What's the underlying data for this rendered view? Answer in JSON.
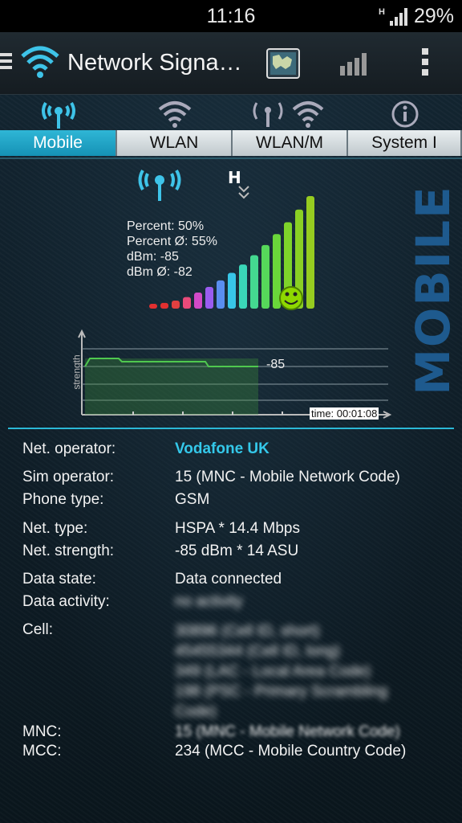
{
  "status_bar": {
    "time": "11:16",
    "network_type": "H",
    "battery": "29%"
  },
  "app_bar": {
    "title": "Network Signa…"
  },
  "tabs": [
    {
      "label": "Mobile",
      "active": true,
      "icon": "antenna-icon"
    },
    {
      "label": "WLAN",
      "active": false,
      "icon": "wifi-icon"
    },
    {
      "label": "WLAN/M",
      "active": false,
      "icon": "antenna-wifi-icon"
    },
    {
      "label": "System I",
      "active": false,
      "icon": "info-icon"
    }
  ],
  "side_label": "MOBILE",
  "signal": {
    "network_indicator": "H",
    "percent": "Percent: 50%",
    "percent_avg": "Percent Ø: 55%",
    "dbm": "dBm: -85",
    "dbm_avg": "dBm Ø: -82",
    "level": 0.5
  },
  "graph": {
    "y_label": "strength",
    "current_value": "-85",
    "time_label": "time: 00:01:08"
  },
  "details": {
    "net_operator": {
      "label": "Net. operator:",
      "value": "Vodafone UK"
    },
    "sim_operator": {
      "label": "Sim operator:",
      "value": "15 (MNC - Mobile Network Code)"
    },
    "phone_type": {
      "label": "Phone type:",
      "value": "GSM"
    },
    "net_type": {
      "label": "Net. type:",
      "value": "HSPA * 14.4 Mbps"
    },
    "net_strength": {
      "label": "Net. strength:",
      "value": "-85 dBm * 14 ASU"
    },
    "data_state": {
      "label": "Data state:",
      "value": "Data connected"
    },
    "data_activity": {
      "label": "Data activity:",
      "value": "no activity"
    },
    "cell": {
      "label": "Cell:",
      "lines": [
        "30896 (Cell ID, short)",
        "45455344 (Cell ID, long)",
        "349 (LAC - Local Area Code)",
        "198 (PSC - Primary Scrambling",
        "Code)"
      ]
    },
    "mnc": {
      "label": "MNC:",
      "value": "15 (MNC - Mobile Network Code)"
    },
    "mcc": {
      "label": "MCC:",
      "value": "234 (MCC - Mobile Country Code)"
    }
  },
  "colors": {
    "accent": "#2bb8d6",
    "operator": "#34c8ea",
    "watermark": "#1e5a8e"
  }
}
